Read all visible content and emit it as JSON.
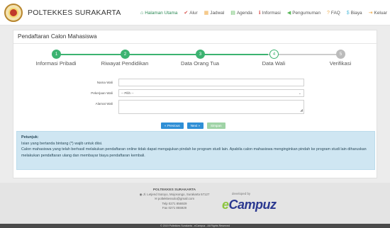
{
  "header": {
    "brand": "POLTEKKES SURAKARTA",
    "nav": [
      {
        "icon": "home-icon",
        "glyph": "⌂",
        "label": "Halaman Utama",
        "active": true
      },
      {
        "icon": "check-icon",
        "glyph": "✔",
        "label": "Alur",
        "active": false
      },
      {
        "icon": "calendar-icon",
        "glyph": "▦",
        "label": "Jadwal",
        "active": false
      },
      {
        "icon": "agenda-icon",
        "glyph": "▤",
        "label": "Agenda",
        "active": false
      },
      {
        "icon": "info-icon",
        "glyph": "ℹ",
        "label": "Informasi",
        "active": false
      },
      {
        "icon": "megaphone-icon",
        "glyph": "◀",
        "label": "Pengumuman",
        "active": false
      },
      {
        "icon": "question-icon",
        "glyph": "?",
        "label": "FAQ",
        "active": false
      },
      {
        "icon": "dollar-icon",
        "glyph": "$",
        "label": "Biaya",
        "active": false
      },
      {
        "icon": "logout-icon",
        "glyph": "⇥",
        "label": "Keluar",
        "active": false
      }
    ],
    "colors": {
      "home": "#2e8b57",
      "alur": "#d9534f",
      "jadwal": "#f0ad4e",
      "agenda": "#5cb85c",
      "info": "#d9534f",
      "pengumuman": "#5cb85c",
      "faq": "#f0ad4e",
      "biaya": "#5bc0de",
      "keluar": "#f0ad4e"
    }
  },
  "card": {
    "title": "Pendaftaran Calon Mahasiswa"
  },
  "steps": [
    {
      "num": "1",
      "label": "Informasi Pribadi",
      "state": "done"
    },
    {
      "num": "2",
      "label": "Riwayat Pendidikan",
      "state": "done"
    },
    {
      "num": "3",
      "label": "Data Orang Tua",
      "state": "done"
    },
    {
      "num": "4",
      "label": "Data Wali",
      "state": "current"
    },
    {
      "num": "5",
      "label": "Verifikasi",
      "state": "todo"
    }
  ],
  "form": {
    "nama_wali": {
      "label": "Nama Wali",
      "value": ""
    },
    "pekerjaan_wali": {
      "label": "Pekerjaan Wali",
      "value": "-- Pilih --"
    },
    "alamat_wali": {
      "label": "Alamat Wali",
      "value": ""
    }
  },
  "buttons": {
    "previous": "« Previous",
    "next": "Next »",
    "save": "Simpan"
  },
  "info": {
    "head": "Petunjuk:",
    "line1": "Isian yang bertanda bintang (*) wajib untuk diisi.",
    "line2": "Calon mahasiswa yang telah berhasil melakukan pendaftaran online tidak dapat mengajukan pindah ke program studi lain. Apabila calon mahasiswa menginginkan pindah ke program studi lain diharuskan melakukan pendaftaran ulang dan membayar biaya pendaftaran kembali."
  },
  "footer": {
    "org": "POLTEKKES SURAKARTA",
    "address": "Jl. Letjend Sutoyo, Mojosongo, Surakarta 57127",
    "email": "poltekkessolo@gmail.com",
    "phone1": "Telp 0271 856929",
    "phone2": "Fax 0271 855929",
    "developed_by": "developed by",
    "product": "Campuz",
    "product_prefix": "e",
    "copyright": "© 2019 Poltekkes Surakarta - eCampuz - All Rights Reserved"
  }
}
